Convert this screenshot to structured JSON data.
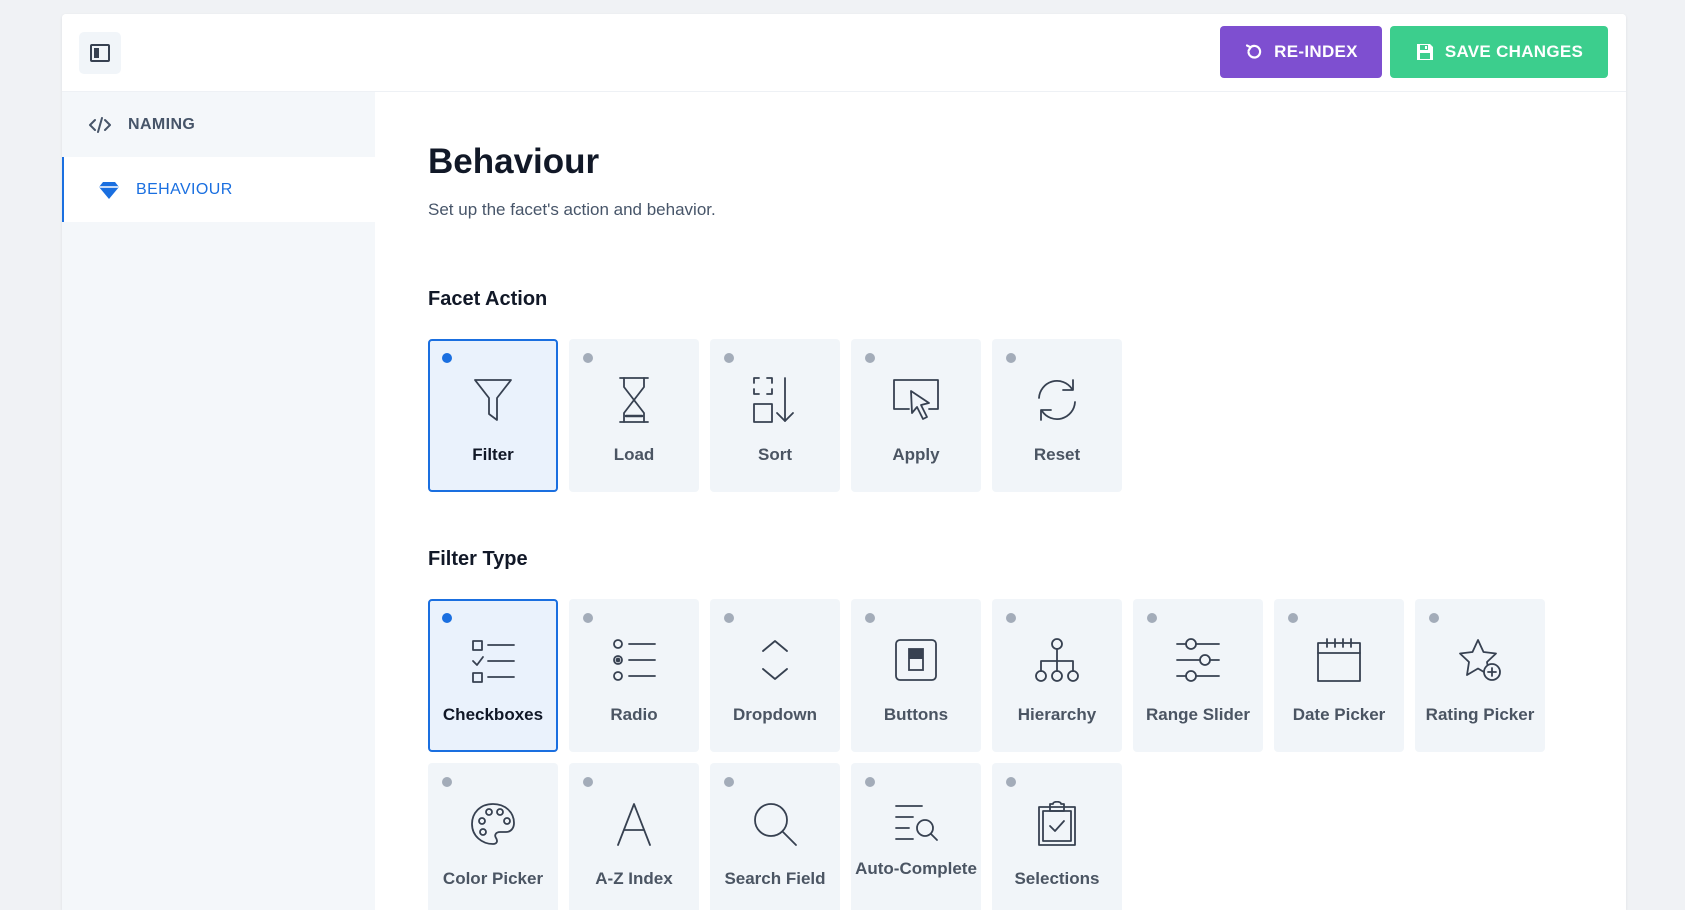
{
  "toolbar": {
    "reindex_label": "RE-INDEX",
    "save_label": "SAVE CHANGES",
    "reindex_color": "#7e4fd0",
    "save_color": "#3cce8d"
  },
  "sidebar": {
    "items": [
      {
        "label": "NAMING",
        "icon": "code-icon",
        "active": false
      },
      {
        "label": "BEHAVIOUR",
        "icon": "diamond-icon",
        "active": true
      }
    ]
  },
  "page": {
    "title": "Behaviour",
    "subtitle": "Set up the facet's action and behavior."
  },
  "facet_action": {
    "title": "Facet Action",
    "options": [
      {
        "label": "Filter",
        "icon": "funnel-icon",
        "selected": true
      },
      {
        "label": "Load",
        "icon": "hourglass-icon",
        "selected": false
      },
      {
        "label": "Sort",
        "icon": "sort-icon",
        "selected": false
      },
      {
        "label": "Apply",
        "icon": "cursor-click-icon",
        "selected": false
      },
      {
        "label": "Reset",
        "icon": "refresh-icon",
        "selected": false
      }
    ]
  },
  "filter_type": {
    "title": "Filter Type",
    "options": [
      {
        "label": "Checkboxes",
        "icon": "checklist-icon",
        "selected": true
      },
      {
        "label": "Radio",
        "icon": "radio-list-icon",
        "selected": false
      },
      {
        "label": "Dropdown",
        "icon": "chevron-updown-icon",
        "selected": false
      },
      {
        "label": "Buttons",
        "icon": "toggle-button-icon",
        "selected": false
      },
      {
        "label": "Hierarchy",
        "icon": "hierarchy-icon",
        "selected": false
      },
      {
        "label": "Range Slider",
        "icon": "sliders-icon",
        "selected": false
      },
      {
        "label": "Date Picker",
        "icon": "calendar-icon",
        "selected": false
      },
      {
        "label": "Rating Picker",
        "icon": "star-plus-icon",
        "selected": false
      },
      {
        "label": "Color Picker",
        "icon": "palette-icon",
        "selected": false
      },
      {
        "label": "A-Z Index",
        "icon": "letter-a-icon",
        "selected": false
      },
      {
        "label": "Search Field",
        "icon": "search-icon",
        "selected": false
      },
      {
        "label": "Auto-Complete",
        "icon": "list-search-icon",
        "selected": false
      },
      {
        "label": "Selections",
        "icon": "clipboard-check-icon",
        "selected": false
      }
    ]
  },
  "colors": {
    "accent": "#1a6fe0",
    "tile_bg": "#f1f5f9",
    "selected_tile_bg": "#eaf2fc",
    "sidebar_bg": "#f4f7fa"
  }
}
